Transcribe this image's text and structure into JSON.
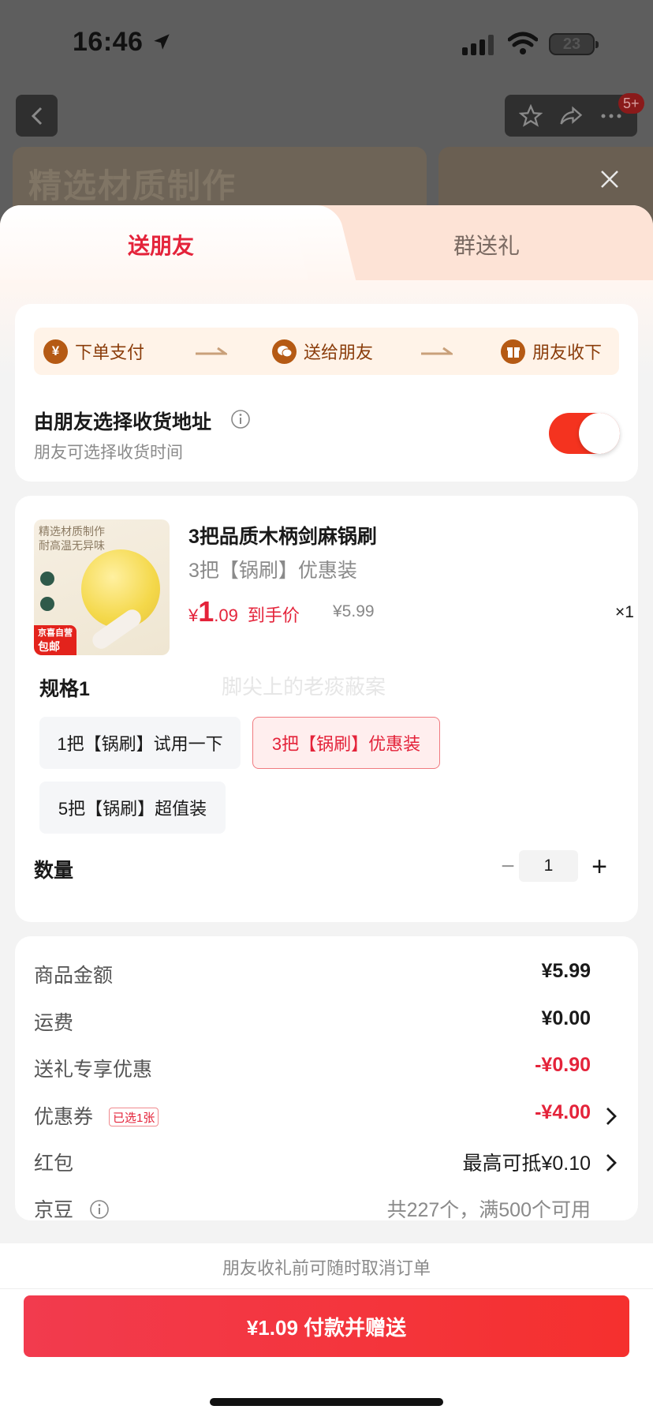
{
  "status_bar": {
    "time": "16:46",
    "battery": "23"
  },
  "background": {
    "badge": "5+",
    "banner_text": "精选材质制作"
  },
  "tabs": [
    {
      "label": "送朋友",
      "active": true
    },
    {
      "label": "群送礼",
      "active": false
    }
  ],
  "flow": {
    "steps": [
      {
        "icon": "yen-icon",
        "label": "下单支付"
      },
      {
        "icon": "wechat-icon",
        "label": "送给朋友"
      },
      {
        "icon": "gift-icon",
        "label": "朋友收下"
      }
    ]
  },
  "address": {
    "title": "由朋友选择收货地址",
    "subtitle": "朋友可选择收货时间",
    "toggle_on": true
  },
  "product": {
    "image_text": [
      "精选材质制作",
      "耐高温无异味"
    ],
    "image_tag": [
      "京喜自营",
      "包邮"
    ],
    "title": "3把品质木柄剑麻锅刷",
    "spec": "3把【锅刷】优惠装",
    "price_currency": "¥",
    "price_int": "1",
    "price_dec": ".09",
    "price_note": "到手价",
    "original_price": "¥5.99",
    "quantity_badge": "×1"
  },
  "spec_section": {
    "label": "规格1",
    "watermark": "脚尖上的老痰蔽案",
    "options": [
      {
        "label": "1把【锅刷】试用一下",
        "selected": false
      },
      {
        "label": "3把【锅刷】优惠装",
        "selected": true
      },
      {
        "label": "5把【锅刷】超值装",
        "selected": false
      }
    ]
  },
  "quantity": {
    "label": "数量",
    "minus": "−",
    "value": "1",
    "plus": "+"
  },
  "summary": {
    "goods_label": "商品金额",
    "goods_value": "¥5.99",
    "shipping_label": "运费",
    "shipping_value": "¥0.00",
    "gift_discount_label": "送礼专享优惠",
    "gift_discount_value": "-¥0.90",
    "coupon_label": "优惠券",
    "coupon_tag": "已选1张",
    "coupon_value": "-¥4.00",
    "redpacket_label": "红包",
    "redpacket_value": "最高可抵¥0.10",
    "jd_beans_label": "京豆",
    "jd_beans_value": "共227个，满500个可用"
  },
  "footer": {
    "note": "朋友收礼前可随时取消订单",
    "pay_button": "¥1.09 付款并赠送"
  },
  "colors": {
    "accent_red": "#e4233a",
    "toggle_on": "#f4331f",
    "flow_brown": "#b55a14",
    "pay_gradient_start": "#f23b4e",
    "pay_gradient_end": "#f5302e"
  }
}
